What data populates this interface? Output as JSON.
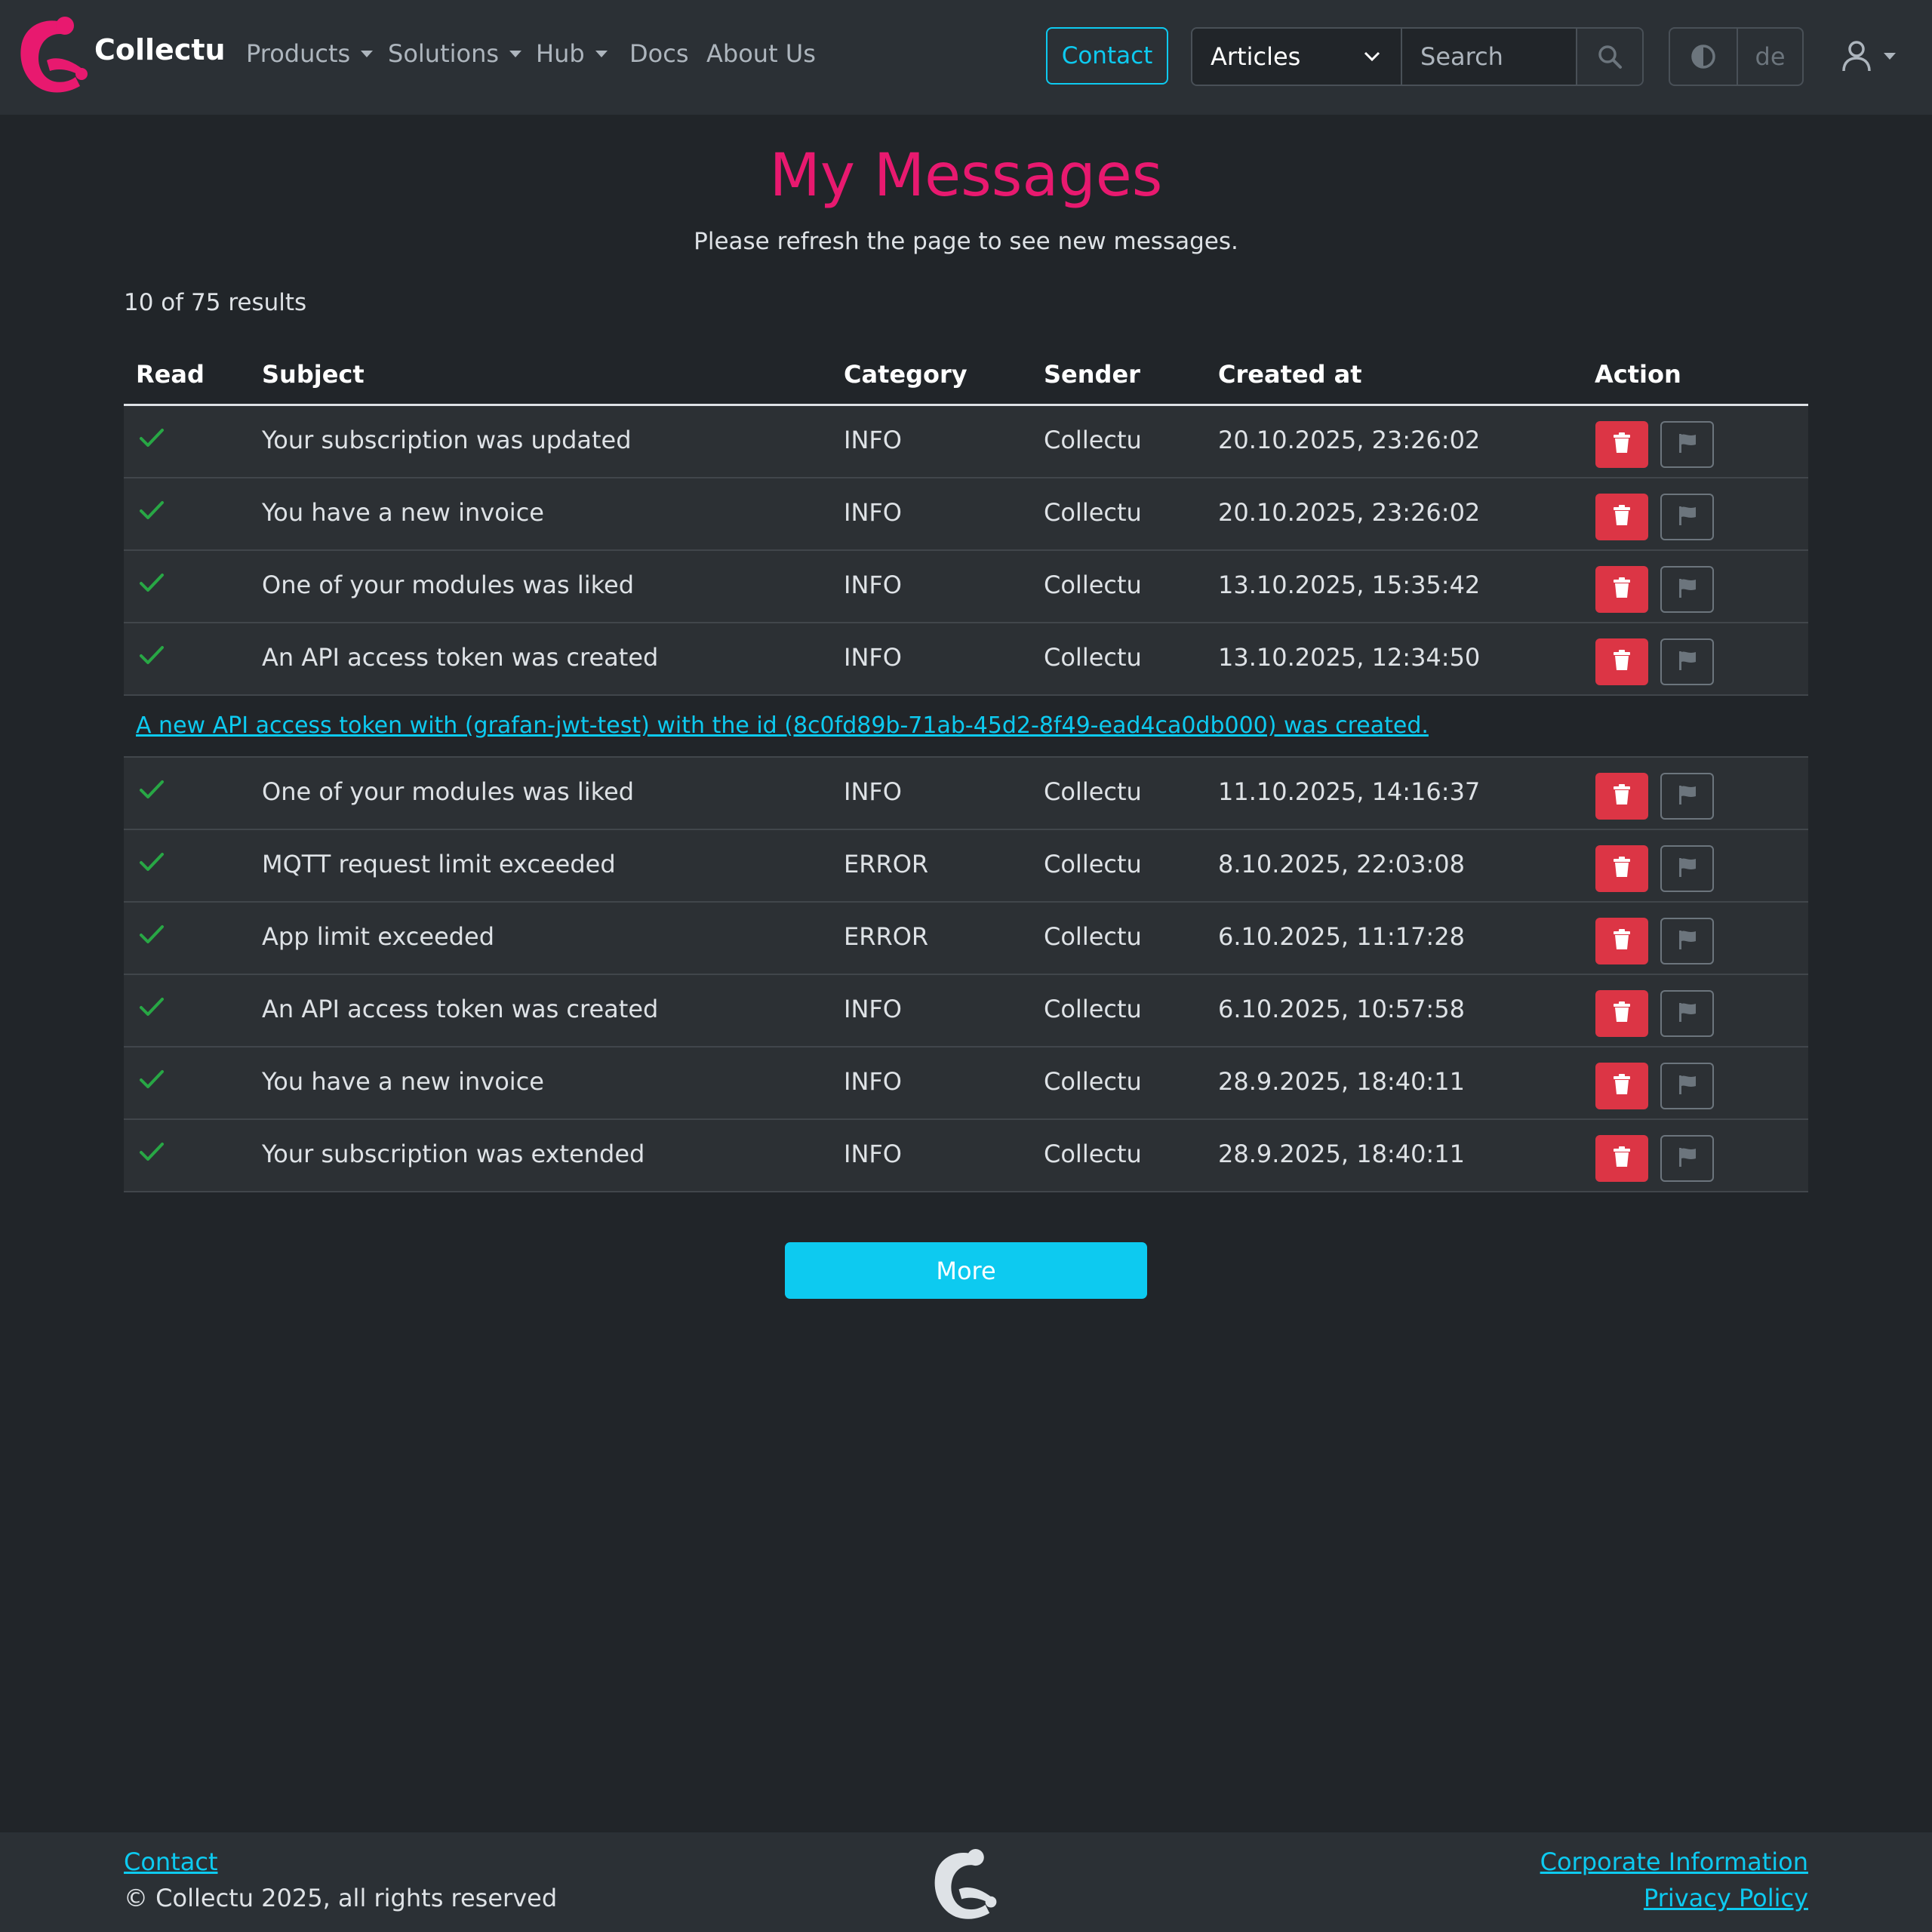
{
  "nav": {
    "brand": "Collectu",
    "links": [
      "Products",
      "Solutions",
      "Hub",
      "Docs",
      "About Us"
    ],
    "contact": "Contact",
    "search_category": "Articles",
    "search_placeholder": "Search",
    "lang": "de"
  },
  "main": {
    "title": "My Messages",
    "subtitle": "Please refresh the page to see new messages.",
    "results": "10 of 75 results",
    "columns": [
      "Read",
      "Subject",
      "Category",
      "Sender",
      "Created at",
      "Action"
    ],
    "rows": [
      {
        "subject": "Your subscription was updated",
        "category": "INFO",
        "sender": "Collectu",
        "created": "20.10.2025, 23:26:02"
      },
      {
        "subject": "You have a new invoice",
        "category": "INFO",
        "sender": "Collectu",
        "created": "20.10.2025, 23:26:02"
      },
      {
        "subject": "One of your modules was liked",
        "category": "INFO",
        "sender": "Collectu",
        "created": "13.10.2025, 15:35:42"
      },
      {
        "subject": "An API access token was created",
        "category": "INFO",
        "sender": "Collectu",
        "created": "13.10.2025, 12:34:50"
      },
      {
        "subject": "One of your modules was liked",
        "category": "INFO",
        "sender": "Collectu",
        "created": "11.10.2025, 14:16:37"
      },
      {
        "subject": "MQTT request limit exceeded",
        "category": "ERROR",
        "sender": "Collectu",
        "created": "8.10.2025, 22:03:08"
      },
      {
        "subject": "App limit exceeded",
        "category": "ERROR",
        "sender": "Collectu",
        "created": "6.10.2025, 11:17:28"
      },
      {
        "subject": "An API access token was created",
        "category": "INFO",
        "sender": "Collectu",
        "created": "6.10.2025, 10:57:58"
      },
      {
        "subject": "You have a new invoice",
        "category": "INFO",
        "sender": "Collectu",
        "created": "28.9.2025, 18:40:11"
      },
      {
        "subject": "Your subscription was extended",
        "category": "INFO",
        "sender": "Collectu",
        "created": "28.9.2025, 18:40:11"
      }
    ],
    "expanded_message": "A new API access token with (grafan-jwt-test) with the id (8c0fd89b-71ab-45d2-8f49-ead4ca0db000) was created.",
    "more": "More"
  },
  "footer": {
    "contact": "Contact",
    "copyright": "© Collectu 2025, all rights reserved",
    "corporate": "Corporate Information",
    "privacy": "Privacy Policy"
  },
  "colors": {
    "brand": "#e8196f",
    "accent": "#0dcaf0",
    "danger": "#dc3545",
    "success": "#28a745",
    "background": "#212529"
  }
}
